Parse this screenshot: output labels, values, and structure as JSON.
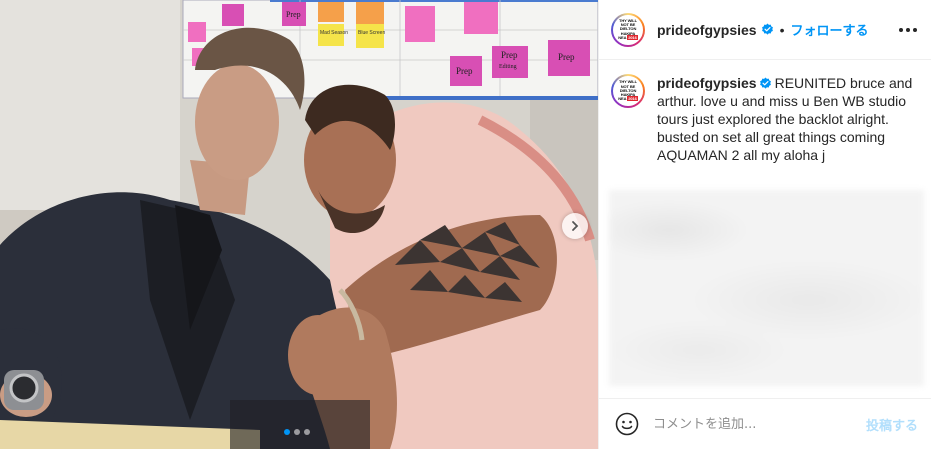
{
  "post": {
    "username": "prideofgypsies",
    "follow_label": "フォローする",
    "separator": "•",
    "avatar_text": [
      "THY WILL",
      "NOT BE",
      "DIELTON",
      "HAKIPA",
      "NEA",
      "2016"
    ],
    "caption": {
      "username": "prideofgypsies",
      "text": "REUNITED bruce and arthur. love u and miss u Ben WB studio tours just explored the backlot alright. busted on set all great things coming AQUAMAN 2 all my aloha j"
    },
    "carousel": {
      "total": 3,
      "current": 1
    }
  },
  "photo_labels": {
    "prep": "Prep",
    "prep_editing": "Editing",
    "notes": [
      "Mad Season",
      "Blue Screen",
      "Unlikely",
      "Pre-Lash"
    ]
  },
  "comment": {
    "placeholder": "コメントを追加...",
    "post_label": "投稿する"
  },
  "colors": {
    "link_blue": "#0095f6",
    "post_disabled": "#b2dffc",
    "sticky_pink": "#f06fc0",
    "sticky_magenta": "#d84fb4",
    "sticky_yellow": "#f5e44a",
    "sticky_orange": "#f5a04a",
    "tattoo": "#3c3432",
    "shirt": "#f0c9c0"
  },
  "icons": [
    "verified-badge-icon",
    "more-options-icon",
    "chevron-right-icon",
    "emoji-icon"
  ]
}
